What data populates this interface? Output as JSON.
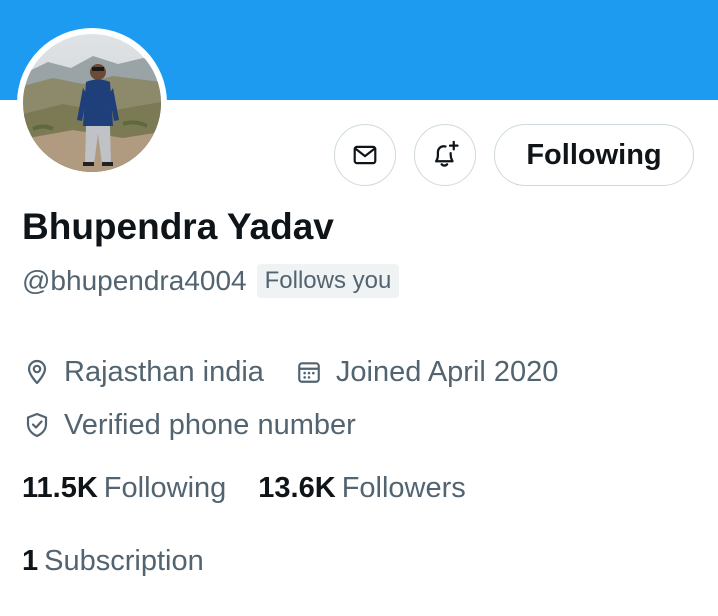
{
  "profile": {
    "name": "Bhupendra Yadav",
    "handle": "@bhupendra4004",
    "follows_you_badge": "Follows you",
    "location": "Rajasthan india",
    "joined": "Joined April 2020",
    "verified": "Verified phone number"
  },
  "actions": {
    "message_icon": "envelope-icon",
    "notify_icon": "bell-plus-icon",
    "following_label": "Following"
  },
  "stats": {
    "following_count": "11.5K",
    "following_label": "Following",
    "followers_count": "13.6K",
    "followers_label": "Followers",
    "subscriptions_count": "1",
    "subscriptions_label": "Subscription"
  },
  "colors": {
    "banner": "#1d9bf0",
    "text_primary": "#0f1419",
    "text_secondary": "#536471",
    "border": "#cfd9de",
    "badge_bg": "#eff3f4"
  }
}
